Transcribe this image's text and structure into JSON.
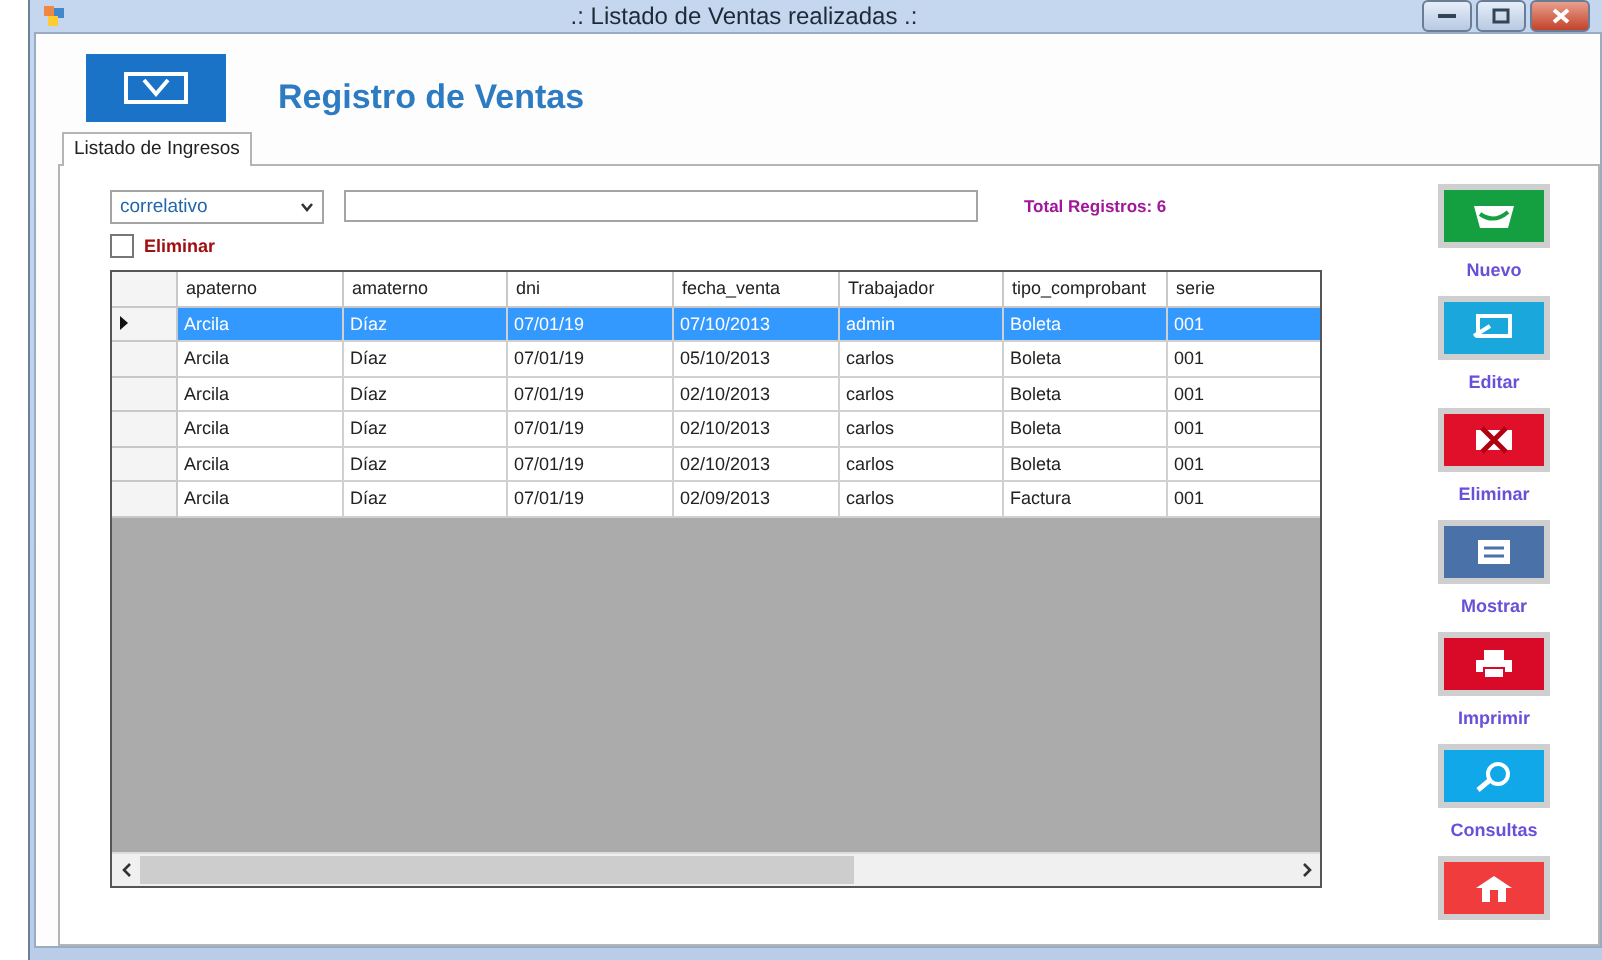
{
  "window": {
    "title": ".: Listado de Ventas realizadas .:"
  },
  "header": {
    "title": "Registro de Ventas"
  },
  "tabs": [
    {
      "label": "Listado de Ingresos",
      "selected": true
    }
  ],
  "filter": {
    "field": "correlativo"
  },
  "total": "Total Registros: 6",
  "delete_checkbox": {
    "label": "Eliminar",
    "checked": false
  },
  "table": {
    "columns": [
      "apaterno",
      "amaterno",
      "dni",
      "fecha_venta",
      "Trabajador",
      "tipo_comprobant",
      "serie"
    ],
    "rows": [
      {
        "selected": true,
        "cells": [
          "Arcila",
          "Díaz",
          "07/01/19",
          "07/10/2013",
          "admin",
          "Boleta",
          "001"
        ]
      },
      {
        "selected": false,
        "cells": [
          "Arcila",
          "Díaz",
          "07/01/19",
          "05/10/2013",
          "carlos",
          "Boleta",
          "001"
        ]
      },
      {
        "selected": false,
        "cells": [
          "Arcila",
          "Díaz",
          "07/01/19",
          "02/10/2013",
          "carlos",
          "Boleta",
          "001"
        ]
      },
      {
        "selected": false,
        "cells": [
          "Arcila",
          "Díaz",
          "07/01/19",
          "02/10/2013",
          "carlos",
          "Boleta",
          "001"
        ]
      },
      {
        "selected": false,
        "cells": [
          "Arcila",
          "Díaz",
          "07/01/19",
          "02/10/2013",
          "carlos",
          "Boleta",
          "001"
        ]
      },
      {
        "selected": false,
        "cells": [
          "Arcila",
          "Díaz",
          "07/01/19",
          "02/09/2013",
          "carlos",
          "Factura",
          "001"
        ]
      }
    ]
  },
  "actions": [
    {
      "kind": "new",
      "label": "Nuevo",
      "color": "#14a040"
    },
    {
      "kind": "edit",
      "label": "Editar",
      "color": "#1aa8dc"
    },
    {
      "kind": "delete",
      "label": "Eliminar",
      "color": "#e0102a"
    },
    {
      "kind": "show",
      "label": "Mostrar",
      "color": "#4a72a8"
    },
    {
      "kind": "print",
      "label": "Imprimir",
      "color": "#d80a28"
    },
    {
      "kind": "search",
      "label": "Consultas",
      "color": "#10a8e8"
    },
    {
      "kind": "home",
      "color": "#f03c3c"
    }
  ]
}
